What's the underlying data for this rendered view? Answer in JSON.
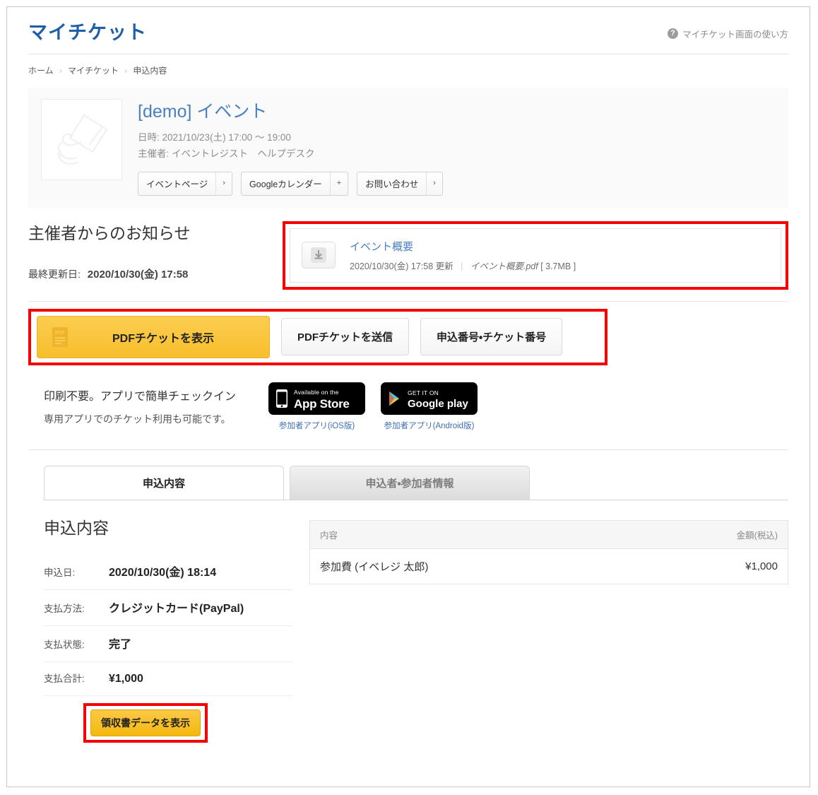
{
  "header": {
    "title": "マイチケット",
    "help_label": "マイチケット画面の使い方",
    "help_icon": "question-circle-icon"
  },
  "breadcrumb": {
    "items": [
      "ホーム",
      "マイチケット",
      "申込内容"
    ],
    "separator": "›"
  },
  "event": {
    "title": "[demo] イベント",
    "datetime": "日時: 2021/10/23(土) 17:00 〜 19:00",
    "organizer": "主催者: イベントレジスト　ヘルプデスク",
    "thumb_alt": "ticket-in-hand-placeholder",
    "buttons": [
      {
        "label": "イベントページ",
        "glyph": "›"
      },
      {
        "label": "Googleカレンダー",
        "glyph": "+"
      },
      {
        "label": "お問い合わせ",
        "glyph": "›"
      }
    ]
  },
  "notice": {
    "heading": "主催者からのお知らせ",
    "last_update_label": "最終更新日:",
    "last_update_value": "2020/10/30(金) 17:58",
    "attachment": {
      "title": "イベント概要",
      "updated": "2020/10/30(金) 17:58 更新",
      "filename": "イベント概要.pdf",
      "filesize": "[ 3.7MB ]",
      "download_icon": "download-arrow-icon"
    }
  },
  "ticket_actions": {
    "primary": {
      "label": "PDFチケットを表示",
      "icon": "pdf-file-icon"
    },
    "secondary": "PDFチケットを送信",
    "tertiary": "申込番号・チケット番号"
  },
  "app_promo": {
    "line1": "印刷不要。アプリで簡単チェックイン",
    "line2": "専用アプリでのチケット利用も可能です。",
    "ios": {
      "badge_small": "Available on the",
      "badge_big": "App Store",
      "caption": "参加者アプリ(iOS版)",
      "icon": "iphone-icon"
    },
    "android": {
      "badge_small": "GET IT ON",
      "badge_big": "Google play",
      "caption": "参加者アプリ(Android版)",
      "icon": "play-triangle-icon"
    }
  },
  "tabs": [
    {
      "label": "申込内容",
      "active": true
    },
    {
      "label": "申込者・参加者情報",
      "active": false
    }
  ],
  "order": {
    "heading": "申込内容",
    "rows": [
      {
        "label": "申込日:",
        "value": "2020/10/30(金) 18:14"
      },
      {
        "label": "支払方法:",
        "value": "クレジットカード(PayPal)"
      },
      {
        "label": "支払状態:",
        "value": "完了"
      },
      {
        "label": "支払合計:",
        "value": "¥1,000"
      }
    ],
    "receipt_button": "領収書データを表示"
  },
  "amount_table": {
    "headers": [
      "内容",
      "金額(税込)"
    ],
    "rows": [
      {
        "item": "参加費 (イベレジ 太郎)",
        "amount": "¥1,000"
      }
    ]
  },
  "colors": {
    "brand_blue": "#1f5fa8",
    "link_blue": "#4a7fc1",
    "accent_yellow": "#f8bf2d",
    "highlight_red": "#f40000"
  }
}
